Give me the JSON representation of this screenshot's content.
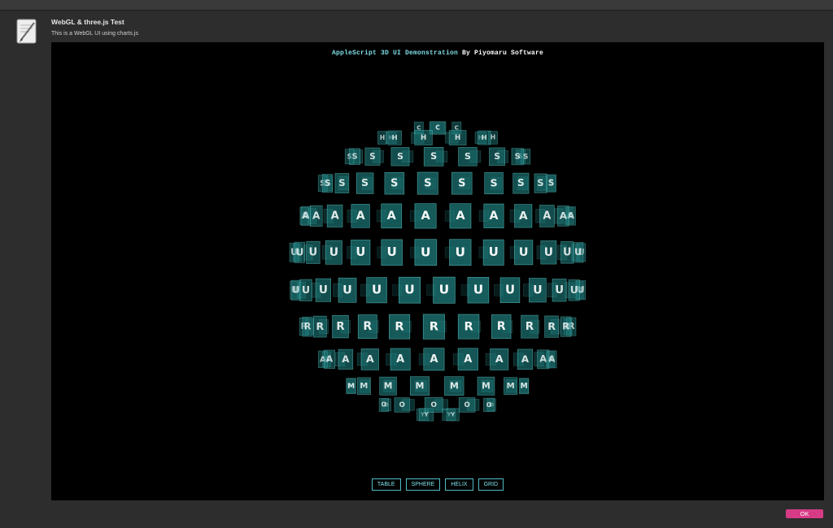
{
  "dialog": {
    "title": "WebGL & three.js Test",
    "subtitle": "This is a WebGL UI using charts.js",
    "app_icon": "script-editor-icon",
    "ok_label": "OK"
  },
  "viewport": {
    "title_part1": "AppleScript 3D UI Demonstration",
    "title_part2": " By Piyomaru Software"
  },
  "sphere": {
    "letters": [
      "C",
      "H",
      "S",
      "S",
      "A",
      "U",
      "U",
      "R",
      "A",
      "M",
      "O",
      "Y"
    ],
    "tile_color": "#1f7f7f",
    "glyph_color": "#ffffff"
  },
  "modes": [
    {
      "label": "TABLE"
    },
    {
      "label": "SPHERE"
    },
    {
      "label": "HELIX"
    },
    {
      "label": "GRID"
    }
  ],
  "colors": {
    "accent": "#7fe4ec",
    "ok_button": "#d83b86",
    "background": "#2d2d2d"
  }
}
